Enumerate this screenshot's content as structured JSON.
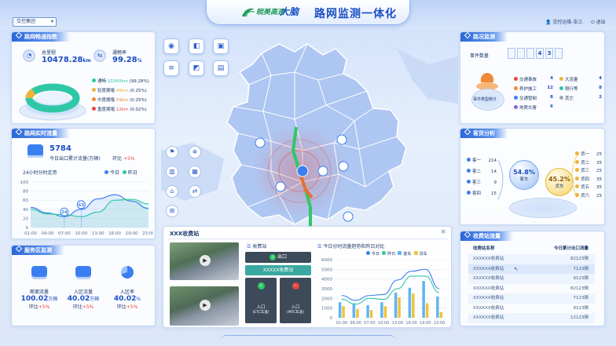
{
  "header": {
    "brand_small": "皖美高速",
    "brand_big": "大脑",
    "title": "路网监测一体化",
    "group": "交控集团",
    "user": "交控运维-张三",
    "exit": "退出"
  },
  "road_index": {
    "title": "路网畅通指数",
    "total_label": "总里程",
    "total_value": "10478.28",
    "total_unit": "km",
    "rate_label": "通畅率",
    "rate_value": "99.28",
    "rate_unit": "%",
    "items": [
      {
        "label": "通畅",
        "value": "10340km",
        "pct": "(99.28%)",
        "color": "#2fc8a7"
      },
      {
        "label": "轻度拥堵",
        "value": "48km",
        "pct": "(0.25%)",
        "color": "#f0b33a"
      },
      {
        "label": "中度拥堵",
        "value": "59km",
        "pct": "(0.25%)",
        "color": "#f08a36"
      },
      {
        "label": "重度拥堵",
        "value": "12km",
        "pct": "(0.02%)",
        "color": "#e8483e"
      }
    ]
  },
  "realtime": {
    "title": "路网实时流量",
    "value": "5784",
    "desc": "今日出口累计流量(万辆)",
    "ring_label": "环比",
    "ring_value": "+5%",
    "chart_title": "24小时分时走势",
    "legend_today": "今日",
    "legend_yesterday": "昨日"
  },
  "service": {
    "title": "服务区监测",
    "items": [
      {
        "label": "断面流量",
        "value": "100.02",
        "unit": "万辆",
        "ring": "环比",
        "pct": "+5%"
      },
      {
        "label": "入区流量",
        "value": "40.02",
        "unit": "万辆",
        "ring": "环比",
        "pct": "+5%"
      },
      {
        "label": "入区率",
        "value": "40.02",
        "unit": "%",
        "ring": "环比",
        "pct": "+5%"
      }
    ]
  },
  "events": {
    "title": "路况监测",
    "count_label": "事件数量",
    "digits": [
      "",
      "",
      "",
      "4",
      "3",
      ""
    ],
    "center_label": "事件类型统计",
    "items": [
      {
        "label": "交通事故",
        "value": "4",
        "color": "#e8483e"
      },
      {
        "label": "大流量",
        "value": "4",
        "color": "#f0b33a"
      },
      {
        "label": "养护施工",
        "value": "12",
        "color": "#f08a36"
      },
      {
        "label": "限行等",
        "value": "8",
        "color": "#2fc8a7"
      },
      {
        "label": "交通管制",
        "value": "8",
        "color": "#3a7ff0"
      },
      {
        "label": "其它",
        "value": "2",
        "color": "#9aa7bd"
      },
      {
        "label": "地质灾害",
        "value": "6",
        "color": "#7b6be0"
      }
    ]
  },
  "passenger": {
    "title": "客货分析",
    "left": [
      {
        "label": "客一",
        "value": "214"
      },
      {
        "label": "客二",
        "value": "14"
      },
      {
        "label": "客三",
        "value": "9"
      },
      {
        "label": "客四",
        "value": "15"
      }
    ],
    "right": [
      {
        "label": "货一",
        "value": "25"
      },
      {
        "label": "货二",
        "value": "35"
      },
      {
        "label": "货三",
        "value": "25"
      },
      {
        "label": "货四",
        "value": "35"
      },
      {
        "label": "货五",
        "value": "35"
      },
      {
        "label": "货六",
        "value": "25"
      }
    ],
    "bus_pct": "54.8%",
    "bus_label": "客车",
    "truck_pct": "45.2%",
    "truck_label": "货车"
  },
  "toll": {
    "title": "收费站流量",
    "col_name": "收费站名称",
    "col_value": "今日累计出口流量",
    "rows": [
      {
        "name": "XXXXXX收费站",
        "value": "82123辆"
      },
      {
        "name": "XXXXXX收费站",
        "value": "7123辆"
      },
      {
        "name": "XXXXXX收费站",
        "value": "9123辆"
      },
      {
        "name": "XXXXXX收费站",
        "value": "82123辆"
      },
      {
        "name": "XXXXXX收费站",
        "value": "7123辆"
      },
      {
        "name": "XXXXXX收费站",
        "value": "9123辆"
      },
      {
        "name": "XXXXXX收费站",
        "value": "12123辆"
      }
    ]
  },
  "popup": {
    "title": "XXX收费站",
    "close": "×",
    "station_label": "收费站",
    "exit_label": "出口",
    "station_name": "XXXXX收费站",
    "entry1": "入口",
    "entry1_sub": "(ETC车道)",
    "entry2": "入口",
    "entry2_sub": "(MTC车道)",
    "compare_title": "今日分时流量趋势和昨日对比",
    "legend": [
      {
        "label": "今日",
        "color": "#3a7ff0"
      },
      {
        "label": "昨日",
        "color": "#2fc8a7"
      },
      {
        "label": "客车",
        "color": "#5fb6f0"
      },
      {
        "label": "货车",
        "color": "#f0c43a"
      }
    ]
  },
  "chart_data": [
    {
      "type": "line",
      "title": "24小时分时走势",
      "xlabel": "",
      "ylabel": "",
      "x": [
        "01:00",
        "04:00",
        "07:00",
        "10:00",
        "13:00",
        "16:00",
        "19:00",
        "23:00"
      ],
      "ylim": [
        0,
        100
      ],
      "yticks": [
        0,
        20,
        40,
        60,
        80,
        100
      ],
      "series": [
        {
          "name": "今日",
          "values": [
            44,
            32,
            24,
            40,
            63,
            72,
            58,
            42
          ],
          "color": "#3a7ff0"
        },
        {
          "name": "昨日",
          "values": [
            40,
            30,
            28,
            24,
            34,
            60,
            62,
            52
          ],
          "color": "#2fc8a7"
        }
      ],
      "annotations": [
        {
          "x": "07:00",
          "label": "24"
        },
        {
          "x": "10:00",
          "label": "63"
        }
      ]
    },
    {
      "type": "bar",
      "title": "今日分时流量趋势和昨日对比",
      "x": [
        "01:00",
        "04:00",
        "07:00",
        "10:00",
        "13:00",
        "16:00",
        "19:00",
        "23:00"
      ],
      "ylim": [
        0,
        6000
      ],
      "yticks": [
        0,
        1000,
        2000,
        3000,
        4000,
        5000,
        6000
      ],
      "series": [
        {
          "name": "客车",
          "values": [
            1600,
            1500,
            1300,
            1600,
            2600,
            3100,
            3800,
            2200
          ],
          "color": "#5fb6f0"
        },
        {
          "name": "货车",
          "values": [
            1200,
            900,
            800,
            1200,
            2100,
            2500,
            1500,
            600
          ],
          "color": "#f0c43a"
        },
        {
          "name": "今日",
          "values": [
            2300,
            1800,
            2300,
            2400,
            3900,
            4800,
            5000,
            3000
          ],
          "color": "#3a7ff0"
        },
        {
          "name": "昨日",
          "values": [
            1900,
            1400,
            2000,
            1900,
            3000,
            4300,
            4300,
            2600
          ],
          "color": "#2fc8a7"
        }
      ]
    }
  ]
}
